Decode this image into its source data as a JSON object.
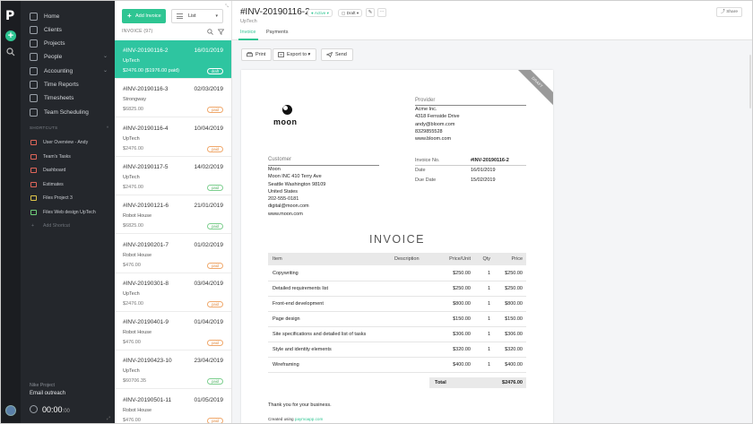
{
  "app": {
    "logo_letter": "P"
  },
  "sidebar": {
    "items": [
      {
        "label": "Home",
        "icon": "home-icon",
        "chevron": ""
      },
      {
        "label": "Clients",
        "icon": "clients-icon",
        "chevron": ""
      },
      {
        "label": "Projects",
        "icon": "folder-icon",
        "chevron": ""
      },
      {
        "label": "People",
        "icon": "people-icon",
        "chevron": "⌄"
      },
      {
        "label": "Accounting",
        "icon": "dollar-icon",
        "chevron": "⌄"
      },
      {
        "label": "Time Reports",
        "icon": "reports-icon",
        "chevron": ""
      },
      {
        "label": "Timesheets",
        "icon": "clock-icon",
        "chevron": ""
      },
      {
        "label": "Team Scheduling",
        "icon": "calendar-icon",
        "chevron": ""
      }
    ],
    "shortcuts_header": "SHORTCUTS",
    "shortcuts": [
      {
        "label": "User Overview - Andy",
        "color": "red"
      },
      {
        "label": "Team's Tasks",
        "color": "red"
      },
      {
        "label": "Dashboard",
        "color": "red"
      },
      {
        "label": "Estimates",
        "color": "red"
      },
      {
        "label": "Files Project 3",
        "color": "yellow"
      },
      {
        "label": "Files Web design UpTech",
        "color": "green"
      }
    ],
    "add_shortcut": "Add Shortcut",
    "project_name": "Nike Project",
    "task_name": "Email outreach",
    "timer": "00:00",
    "timer_sec": "00"
  },
  "list": {
    "add_button": "Add Invoice",
    "view_label": "List",
    "header": "INVOICE (97)",
    "rows": [
      {
        "num": "#INV-20190116-2",
        "date": "16/01/2019",
        "client": "UpTech",
        "amount": "$2476.00 ($1976.00 paid)",
        "status": "draft",
        "paid": false,
        "selected": true
      },
      {
        "num": "#INV-20190116-3",
        "date": "02/03/2019",
        "client": "Strongway",
        "amount": "$6825.00",
        "status": "paid",
        "paid": false,
        "selected": false
      },
      {
        "num": "#INV-20190116-4",
        "date": "10/04/2019",
        "client": "UpTech",
        "amount": "$2476.00",
        "status": "paid",
        "paid": false,
        "selected": false
      },
      {
        "num": "#INV-20190117-5",
        "date": "14/02/2019",
        "client": "UpTech",
        "amount": "$2476.00",
        "status": "paid",
        "paid": true,
        "selected": false
      },
      {
        "num": "#INV-20190121-6",
        "date": "21/01/2019",
        "client": "Robot House",
        "amount": "$6825.00",
        "status": "paid",
        "paid": true,
        "selected": false
      },
      {
        "num": "#INV-20190201-7",
        "date": "01/02/2019",
        "client": "Robot House",
        "amount": "$476.00",
        "status": "paid",
        "paid": false,
        "selected": false
      },
      {
        "num": "#INV-20190301-8",
        "date": "03/04/2019",
        "client": "UpTech",
        "amount": "$2476.00",
        "status": "paid",
        "paid": false,
        "selected": false
      },
      {
        "num": "#INV-20190401-9",
        "date": "01/04/2019",
        "client": "Robot House",
        "amount": "$476.00",
        "status": "paid",
        "paid": false,
        "selected": false
      },
      {
        "num": "#INV-20190423-10",
        "date": "23/04/2019",
        "client": "UpTech",
        "amount": "$60706.35",
        "status": "paid",
        "paid": true,
        "selected": false
      },
      {
        "num": "#INV-20190501-11",
        "date": "01/05/2019",
        "client": "Robot House",
        "amount": "$476.00",
        "status": "paid",
        "paid": false,
        "selected": false
      }
    ]
  },
  "header": {
    "title": "#INV-20190116-2",
    "subtitle": "UpTech",
    "status_active": "Active",
    "status_draft": "Draft",
    "share": "Share",
    "tabs": [
      "Invoice",
      "Payments"
    ]
  },
  "actions": {
    "print": "Print",
    "export": "Export to",
    "send": "Send"
  },
  "invoice": {
    "ribbon": "DRAFT",
    "brand": "moon",
    "provider_label": "Provider",
    "provider_lines": [
      "Acme Inc.",
      "4318 Fernside Drive",
      "andy@bloom.com",
      "8329855528",
      "www.bloom.com"
    ],
    "customer_label": "Customer",
    "customer_lines": [
      "Moon",
      "Moon INC 410 Terry Ave",
      "Seattle Washington 98109",
      "United States",
      "202-555-0181",
      "digital@moon.com",
      "www.moon.com"
    ],
    "meta": [
      {
        "label": "Invoice No.",
        "value": "#INV-20190116-2",
        "bold": true
      },
      {
        "label": "Date",
        "value": "16/01/2019",
        "bold": false
      },
      {
        "label": "Due Date",
        "value": "15/02/2019",
        "bold": false
      }
    ],
    "heading": "INVOICE",
    "columns": [
      "Item",
      "Description",
      "Price/Unit",
      "Qty",
      "Price"
    ],
    "items": [
      {
        "item": "Copywriting",
        "description": "",
        "price_unit": "$250.00",
        "qty": "1",
        "price": "$250.00"
      },
      {
        "item": "Detailed requirements list",
        "description": "",
        "price_unit": "$250.00",
        "qty": "1",
        "price": "$250.00"
      },
      {
        "item": "Front-end development",
        "description": "",
        "price_unit": "$800.00",
        "qty": "1",
        "price": "$800.00"
      },
      {
        "item": "Page design",
        "description": "",
        "price_unit": "$150.00",
        "qty": "1",
        "price": "$150.00"
      },
      {
        "item": "Site specifications and detailed list of tasks",
        "description": "",
        "price_unit": "$306.00",
        "qty": "1",
        "price": "$306.00"
      },
      {
        "item": "Style and identity elements",
        "description": "",
        "price_unit": "$320.00",
        "qty": "1",
        "price": "$320.00"
      },
      {
        "item": "Wireframing",
        "description": "",
        "price_unit": "$400.00",
        "qty": "1",
        "price": "$400.00"
      }
    ],
    "total_label": "Total",
    "total_value": "$2476.00",
    "thanks": "Thank you for your business.",
    "created_prefix": "Created using",
    "created_link": "paymoapp.com"
  },
  "colors": {
    "accent": "#2ec592",
    "sidebar_bg": "#24272c",
    "rail_bg": "#1b1d21",
    "draft_badge": "#f0a86b"
  }
}
